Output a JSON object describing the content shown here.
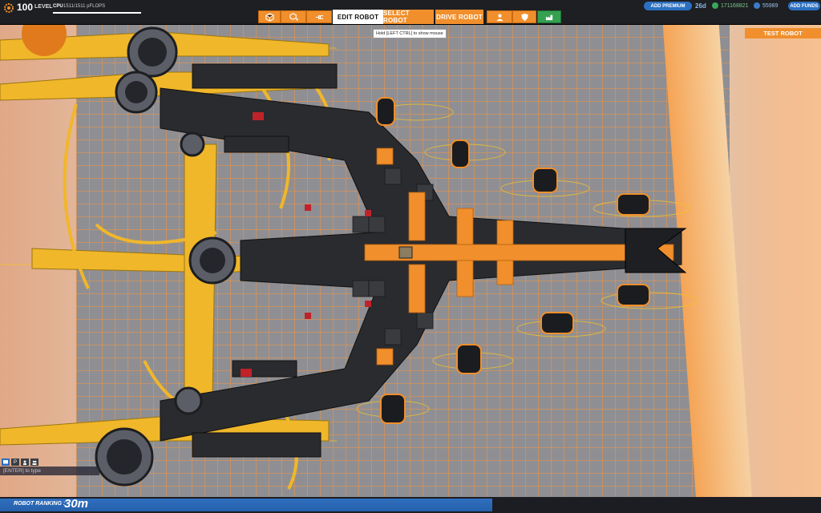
{
  "topbar": {
    "level": "100",
    "level_label": "LEVEL",
    "cpu_label": "CPU",
    "cpu_value": "1511/1511 pFLOPS",
    "cpu_fraction": 1.0,
    "tool_buttons": [
      "cube-icon",
      "cube-add-icon",
      "connector-icon"
    ],
    "modes": [
      "EDIT ROBOT",
      "SELECT ROBOT",
      "DRIVE ROBOT"
    ],
    "right_buttons": [
      "player-icon",
      "shield-icon",
      "factory-icon"
    ],
    "tooltip": "Hold [LEFT CTRL] to show mouse",
    "add_premium": "ADD PREMIUM",
    "premium_days": "26d",
    "robits": "171168821",
    "cosmetic_credits": "55989",
    "add_funds": "ADD FUNDS"
  },
  "test_robot": "TEST ROBOT",
  "chat": {
    "tabs": [
      "",
      "P",
      "",
      ""
    ],
    "input_placeholder": "[ENTER] to type"
  },
  "ranking": {
    "label": "ROBOT RANKING :",
    "value": "30m",
    "fraction": 0.6
  },
  "colors": {
    "accent_orange": "#f08f2c",
    "premium_blue": "#2b6fc0",
    "robits_green": "#3ba55b"
  }
}
